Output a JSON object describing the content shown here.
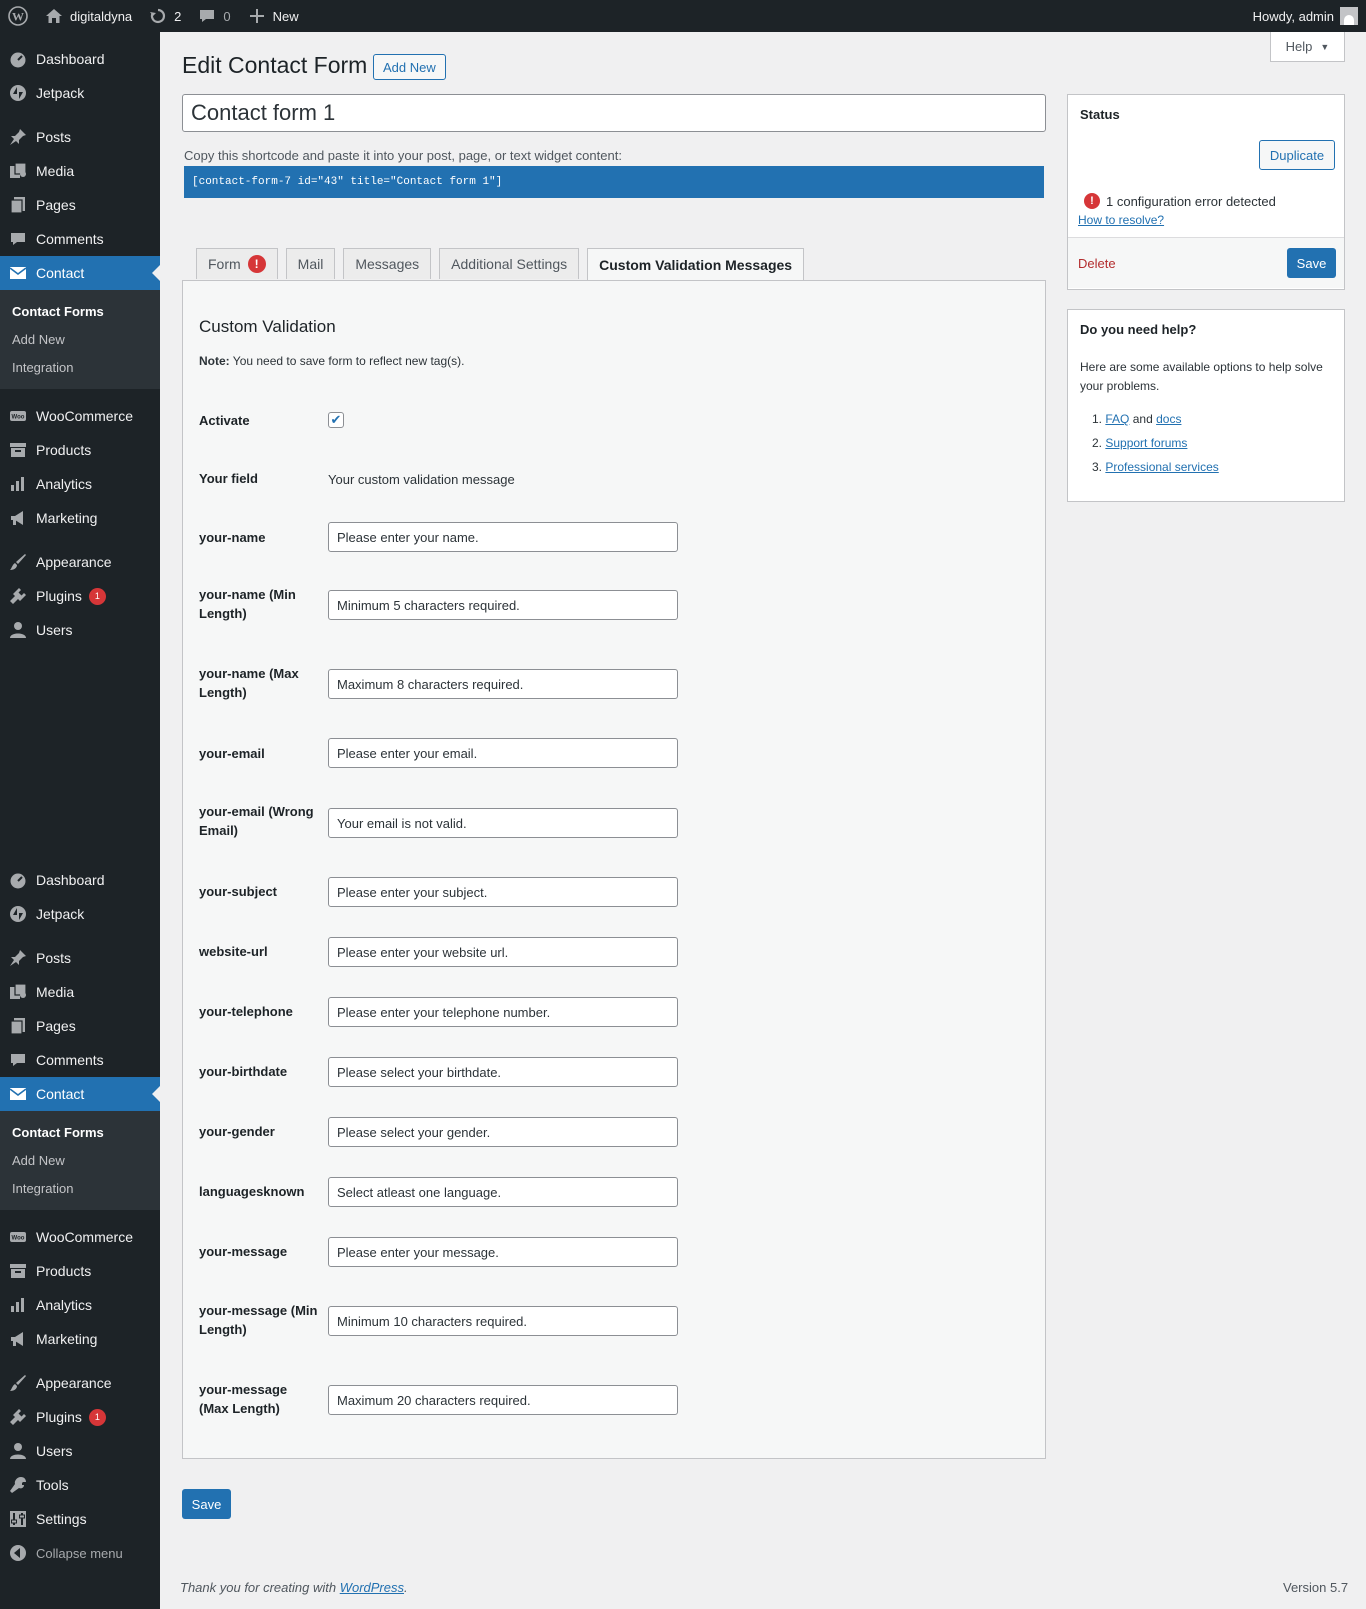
{
  "adminbar": {
    "site_name": "digitaldyna",
    "updates_count": "2",
    "comments_count": "0",
    "new_label": "New",
    "howdy": "Howdy, admin"
  },
  "sidebar": {
    "menu": [
      {
        "label": "Dashboard",
        "icon": "dashboard-icon"
      },
      {
        "label": "Jetpack",
        "icon": "jetpack-icon"
      },
      {
        "label": "Posts",
        "icon": "pin-icon"
      },
      {
        "label": "Media",
        "icon": "media-icon"
      },
      {
        "label": "Pages",
        "icon": "pages-icon"
      },
      {
        "label": "Comments",
        "icon": "comment-icon"
      },
      {
        "label": "Contact",
        "icon": "mail-icon"
      },
      {
        "label": "WooCommerce",
        "icon": "woo-icon"
      },
      {
        "label": "Products",
        "icon": "archive-icon"
      },
      {
        "label": "Analytics",
        "icon": "chart-bar-icon"
      },
      {
        "label": "Marketing",
        "icon": "megaphone-icon"
      },
      {
        "label": "Appearance",
        "icon": "brush-icon"
      },
      {
        "label": "Plugins",
        "icon": "plug-icon",
        "badge": "1"
      },
      {
        "label": "Users",
        "icon": "users-icon"
      },
      {
        "label": "Tools",
        "icon": "wrench-icon"
      },
      {
        "label": "Settings",
        "icon": "settings-icon"
      },
      {
        "label": "Collapse menu",
        "icon": "collapse-icon"
      }
    ],
    "submenu": [
      "Contact Forms",
      "Add New",
      "Integration"
    ]
  },
  "help_tab": "Help",
  "page": {
    "title": "Edit Contact Form",
    "add_new": "Add New",
    "form_title": "Contact form 1",
    "shortcode_label": "Copy this shortcode and paste it into your post, page, or text widget content:",
    "shortcode": "[contact-form-7 id=\"43\" title=\"Contact form 1\"]"
  },
  "tabs": [
    "Form",
    "Mail",
    "Messages",
    "Additional Settings",
    "Custom Validation Messages"
  ],
  "panel": {
    "title": "Custom Validation",
    "note_bold": "Note:",
    "note": "You need to save form to reflect new tag(s).",
    "activate_label": "Activate",
    "activate_checked": true,
    "field_head": "Your field",
    "message_head": "Your custom validation message",
    "rows": [
      {
        "field": "your-name",
        "message": "Please enter your name."
      },
      {
        "field": "your-name (Min Length)",
        "message": "Minimum 5 characters required."
      },
      {
        "field": "your-name (Max Length)",
        "message": "Maximum 8 characters required."
      },
      {
        "field": "your-email",
        "message": "Please enter your email."
      },
      {
        "field": "your-email (Wrong Email)",
        "message": "Your email is not valid."
      },
      {
        "field": "your-subject",
        "message": "Please enter your subject."
      },
      {
        "field": "website-url",
        "message": "Please enter your website url."
      },
      {
        "field": "your-telephone",
        "message": "Please enter your telephone number."
      },
      {
        "field": "your-birthdate",
        "message": "Please select your birthdate."
      },
      {
        "field": "your-gender",
        "message": "Please select your gender."
      },
      {
        "field": "languagesknown",
        "message": "Select atleast one language."
      },
      {
        "field": "your-message",
        "message": "Please enter your message."
      },
      {
        "field": "your-message (Min Length)",
        "message": "Minimum 10 characters required."
      },
      {
        "field": "your-message (Max Length)",
        "message": "Maximum 20 characters required."
      }
    ],
    "save": "Save"
  },
  "status_box": {
    "title": "Status",
    "duplicate": "Duplicate",
    "error_text": "1 configuration error detected",
    "resolve_link": "How to resolve?",
    "delete": "Delete",
    "save": "Save"
  },
  "help_box": {
    "title": "Do you need help?",
    "text": "Here are some available options to help solve your problems.",
    "item1_num": "1.",
    "item1_faq": "FAQ",
    "item1_and": "and",
    "item1_docs": "docs",
    "item2_num": "2.",
    "item2": "Support forums",
    "item3_num": "3.",
    "item3": "Professional services"
  },
  "footer": {
    "thanks": "Thank you for creating with",
    "wp_link": "WordPress",
    "period": ".",
    "version": "Version 5.7"
  },
  "colors": {
    "accent": "#2271b1",
    "adminbar": "#1d2327",
    "error": "#d63638"
  }
}
